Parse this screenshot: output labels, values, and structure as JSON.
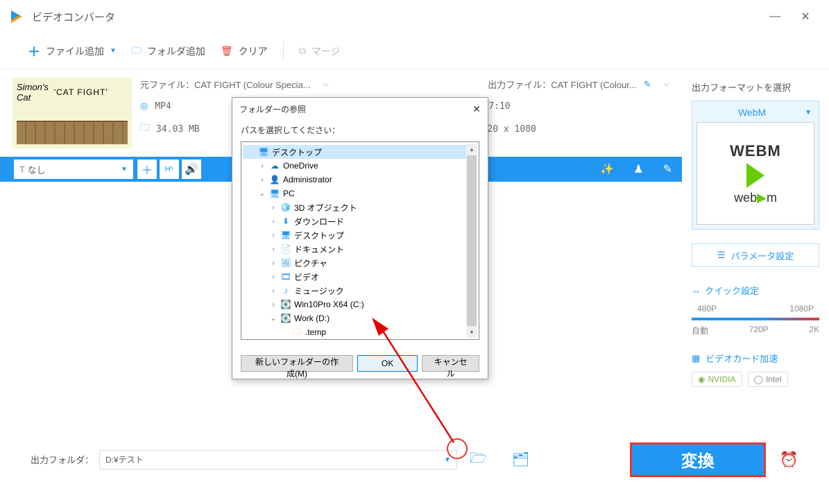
{
  "app": {
    "title": "ビデオコンバータ"
  },
  "toolbar": {
    "add_file": "ファイル追加",
    "add_folder": "フォルダ追加",
    "clear": "クリア",
    "merge": "マージ"
  },
  "video": {
    "thumb_title1": "Simon's",
    "thumb_title2": "Cat",
    "thumb_caption": "'CAT FIGHT'",
    "src_label": "元ファイル：",
    "src_name": "CAT FIGHT (Colour Specia...",
    "out_label": "出力ファイル：",
    "out_name": "CAT FIGHT (Colour...",
    "format": "MP4",
    "size": "34.03 MB",
    "duration": "00:07:10",
    "resolution": "1920 x 1080"
  },
  "subbar": {
    "subtitle": "なし"
  },
  "right": {
    "head": "出力フォーマットを選択",
    "format": "WebM",
    "webm_top": "WEBM",
    "webm_bot": "web▶m",
    "param": "パラメータ設定",
    "quick": "クイック設定",
    "p480": "480P",
    "p1080": "1080P",
    "auto": "自動",
    "p720": "720P",
    "p2k": "2K",
    "gpu": "ビデオカード加速",
    "nvidia": "NVIDIA",
    "intel": "Intel"
  },
  "bottom": {
    "label": "出力フォルダ：",
    "path": "D:¥テスト",
    "convert": "変換"
  },
  "dialog": {
    "title": "フォルダーの参照",
    "prompt": "パスを選択してください：",
    "new_folder": "新しいフォルダーの作成(M)",
    "ok": "OK",
    "cancel": "キャンセル",
    "tree": {
      "desktop": "デスクトップ",
      "onedrive": "OneDrive",
      "admin": "Administrator",
      "pc": "PC",
      "obj3d": "3D オブジェクト",
      "downloads": "ダウンロード",
      "desktop2": "デスクトップ",
      "documents": "ドキュメント",
      "pictures": "ピクチャ",
      "videos": "ビデオ",
      "music": "ミュージック",
      "cdrive": "Win10Pro X64 (C:)",
      "ddrive": "Work (D:)",
      "temp": ".temp"
    }
  }
}
